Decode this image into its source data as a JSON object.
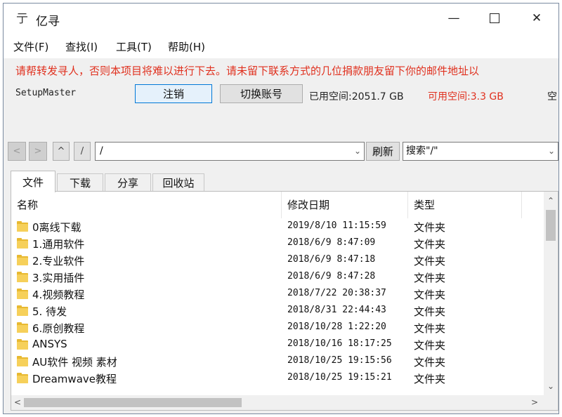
{
  "window": {
    "title": "亿寻",
    "app_icon_glyph": "亍"
  },
  "menu": [
    "文件(F)",
    "查找(I)",
    "工具(T)",
    "帮助(H)"
  ],
  "notice": "请帮转发寻人，否则本项目将难以进行下去。请未留下联系方式的几位捐款朋友留下你的邮件地址以",
  "account": {
    "user": "SetupMaster",
    "logout_label": "注销",
    "switch_label": "切换账号",
    "used_label": "已用空间:2051.7 GB",
    "free_label": "可用空间:3.3 GB",
    "overflow_label": "空",
    "free_color": "#e0301e"
  },
  "nav": {
    "back_glyph": "<",
    "forward_glyph": ">",
    "up_glyph": "^",
    "root_glyph": "/",
    "path_value": "/",
    "refresh_label": "刷新",
    "search_value": "搜索\"/\""
  },
  "tabs": [
    "文件",
    "下载",
    "分享",
    "回收站"
  ],
  "columns": {
    "name": "名称",
    "date": "修改日期",
    "type": "类型"
  },
  "rows": [
    {
      "name": "0离线下载",
      "date": "2019/8/10 11:15:59",
      "type": "文件夹"
    },
    {
      "name": "1.通用软件",
      "date": "2018/6/9 8:47:09",
      "type": "文件夹"
    },
    {
      "name": "2.专业软件",
      "date": "2018/6/9 8:47:18",
      "type": "文件夹"
    },
    {
      "name": "3.实用插件",
      "date": "2018/6/9 8:47:28",
      "type": "文件夹"
    },
    {
      "name": "4.视频教程",
      "date": "2018/7/22 20:38:37",
      "type": "文件夹"
    },
    {
      "name": "5. 待发",
      "date": "2018/8/31 22:44:43",
      "type": "文件夹"
    },
    {
      "name": "6.原创教程",
      "date": "2018/10/28 1:22:20",
      "type": "文件夹"
    },
    {
      "name": "ANSYS",
      "date": "2018/10/16 18:17:25",
      "type": "文件夹"
    },
    {
      "name": "AU软件 视频 素材",
      "date": "2018/10/25 19:15:56",
      "type": "文件夹"
    },
    {
      "name": "Dreamwave教程",
      "date": "2018/10/25 19:15:21",
      "type": "文件夹"
    }
  ]
}
